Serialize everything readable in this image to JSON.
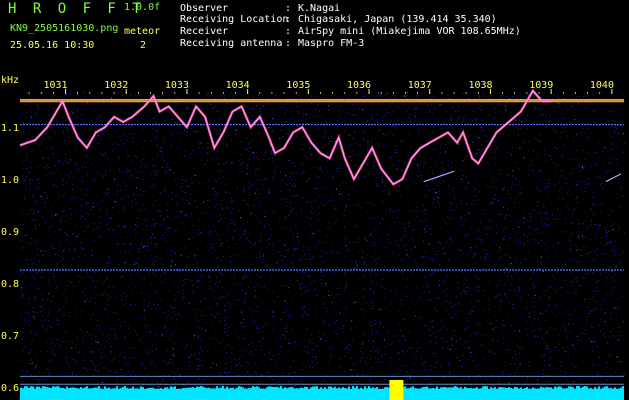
{
  "header": {
    "brand": "H R O F F T",
    "version": "1.0.0f",
    "filename": "KN9_2505161030.png",
    "meteor_label": "meteor",
    "timestamp": "25.05.16 10:30",
    "meteor_count": "2"
  },
  "info": [
    {
      "label": "Observer",
      "value": "K.Nagai"
    },
    {
      "label": "Receiving Location",
      "value": "Chigasaki, Japan (139.414 35.340)"
    },
    {
      "label": "Receiver",
      "value": "AirSpy mini (Miakejima VOR 108.65MHz)"
    },
    {
      "label": "Receiving antenna",
      "value": "Maspro FM-3"
    }
  ],
  "colon": ":",
  "chart_data": {
    "type": "spectrogram",
    "ylabel": "kHz",
    "y_ticks": [
      "1.1",
      "1.0",
      "0.9",
      "0.8",
      "0.7",
      "0.6"
    ],
    "y_values": [
      1.1,
      1.0,
      0.9,
      0.8,
      0.7,
      0.6
    ],
    "ylim": [
      0.59,
      1.16
    ],
    "time_labels": [
      "1031",
      "1032",
      "1033",
      "1034",
      "1035",
      "1036",
      "1037",
      "1038",
      "1039",
      "1040"
    ],
    "xlim": [
      1030.25,
      1040.2
    ],
    "carrier_khz": 1.15,
    "line_khz": [
      1.105,
      0.825,
      0.62,
      0.605
    ],
    "meteor_echo_time": 1036.45,
    "colors": {
      "text_green": "#7fff3f",
      "text_yellow": "#ffff55",
      "carrier": "#ff9933",
      "background": "#000000",
      "noise": "#1e1ea0",
      "baseline": "#00e5ff"
    }
  }
}
